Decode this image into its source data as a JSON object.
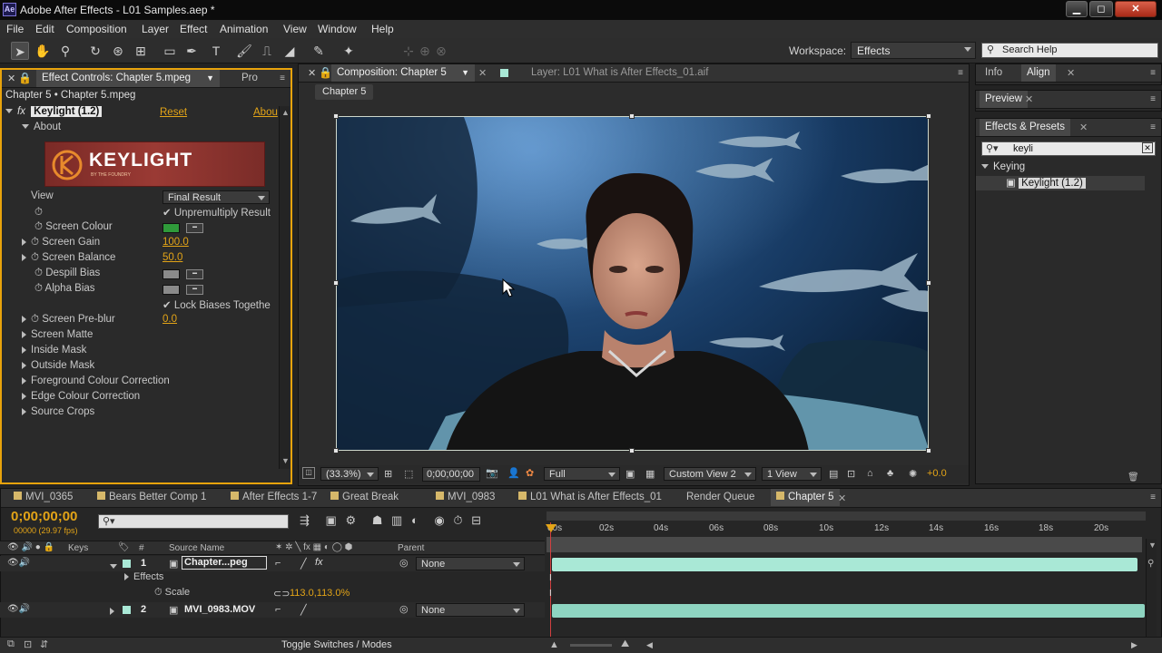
{
  "titlebar": {
    "app_icon": "Ae",
    "title": "Adobe After Effects - L01 Samples.aep *",
    "minimize": "▁",
    "maximize": "◻",
    "close": "✕"
  },
  "menu": [
    "File",
    "Edit",
    "Composition",
    "Layer",
    "Effect",
    "Animation",
    "View",
    "Window",
    "Help"
  ],
  "toolbar": {
    "workspace_label": "Workspace:",
    "workspace_value": "Effects",
    "search_placeholder": "Search Help"
  },
  "effect_controls": {
    "tabs": [
      "Effect Controls: Chapter 5.mpeg",
      "Pro"
    ],
    "subject": "Chapter 5 • Chapter 5.mpeg",
    "effect_name": "Keylight (1.2)",
    "reset": "Reset",
    "about_link": "Abou",
    "about_group": "About",
    "logo_text": "KEYLIGHT",
    "logo_sub": "BY THE FOUNDRY",
    "view_label": "View",
    "view_value": "Final Result",
    "unpremultiply": "Unpremultiply Result",
    "screen_colour": "Screen Colour",
    "screen_gain": "Screen Gain",
    "screen_gain_value": "100.0",
    "screen_balance": "Screen Balance",
    "screen_balance_value": "50.0",
    "despill_bias": "Despill Bias",
    "alpha_bias": "Alpha Bias",
    "lock_biases": "Lock Biases Togethe",
    "screen_preblur": "Screen Pre-blur",
    "screen_preblur_value": "0.0",
    "groups": [
      "Screen Matte",
      "Inside Mask",
      "Outside Mask",
      "Foreground Colour Correction",
      "Edge Colour Correction",
      "Source Crops"
    ],
    "colors": {
      "screen": "#2f9a3a",
      "despill": "#8a8a8a",
      "alpha": "#8a8a8a"
    }
  },
  "composition": {
    "tab_comp": "Composition: Chapter 5",
    "tab_layer": "Layer: L01 What is After Effects_01.aif",
    "breadcrumb": "Chapter 5",
    "zoom": "(33.3%)",
    "timecode": "0;00;00;00",
    "resolution": "Full",
    "view": "Custom View 2",
    "views_count": "1 View",
    "exposure": "+0.0"
  },
  "right_panels": {
    "info": "Info",
    "align": "Align",
    "preview": "Preview",
    "effects_presets": "Effects & Presets",
    "search_value": "keyli",
    "category": "Keying",
    "result": "Keylight (1.2)"
  },
  "timeline": {
    "tabs": [
      "MVI_0365",
      "Bears Better Comp 1",
      "After Effects 1-7",
      "Great Break",
      "MVI_0983",
      "L01 What is After Effects_01",
      "Render Queue",
      "Chapter 5"
    ],
    "timecode": "0;00;00;00",
    "fps": "00000 (29.97 fps)",
    "col_keys": "Keys",
    "col_num": "#",
    "col_source": "Source Name",
    "col_parent": "Parent",
    "ruler": [
      "00s",
      "02s",
      "04s",
      "06s",
      "08s",
      "10s",
      "12s",
      "14s",
      "16s",
      "18s",
      "20s"
    ],
    "layers": [
      {
        "num": "1",
        "name": "Chapter...peg",
        "parent": "None"
      },
      {
        "num": "2",
        "name": "MVI_0983.MOV",
        "parent": "None"
      }
    ],
    "effects_label": "Effects",
    "scale_label": "Scale",
    "scale_value": "113.0,113.0%",
    "toggle_label": "Toggle Switches / Modes"
  }
}
